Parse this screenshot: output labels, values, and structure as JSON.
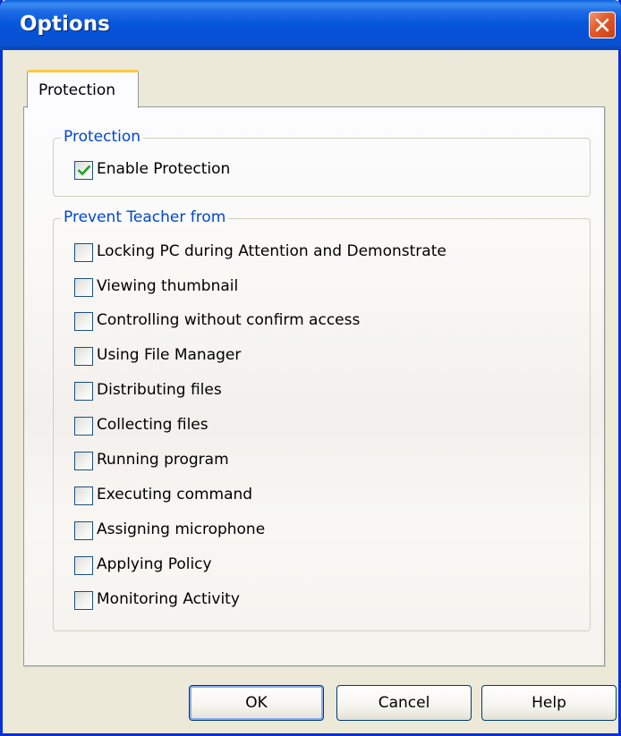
{
  "window": {
    "title": "Options"
  },
  "tabs": [
    {
      "label": "Protection",
      "selected": true
    }
  ],
  "protection_group": {
    "label": "Protection",
    "enable": {
      "label": "Enable Protection",
      "checked": true
    }
  },
  "prevent_group": {
    "label": "Prevent Teacher from",
    "items": [
      {
        "label": "Locking PC during Attention and Demonstrate",
        "checked": false
      },
      {
        "label": "Viewing thumbnail",
        "checked": false
      },
      {
        "label": "Controlling without confirm access",
        "checked": false
      },
      {
        "label": "Using File Manager",
        "checked": false
      },
      {
        "label": "Distributing files",
        "checked": false
      },
      {
        "label": "Collecting files",
        "checked": false
      },
      {
        "label": "Running program",
        "checked": false
      },
      {
        "label": "Executing command",
        "checked": false
      },
      {
        "label": "Assigning microphone",
        "checked": false
      },
      {
        "label": "Applying Policy",
        "checked": false
      },
      {
        "label": "Monitoring Activity",
        "checked": false
      }
    ]
  },
  "buttons": {
    "ok": "OK",
    "cancel": "Cancel",
    "help": "Help"
  },
  "colors": {
    "titlebar": "#0858dc",
    "group_label": "#0046d5",
    "check_mark": "#21a121",
    "dialog_background": "#ece9d8"
  }
}
